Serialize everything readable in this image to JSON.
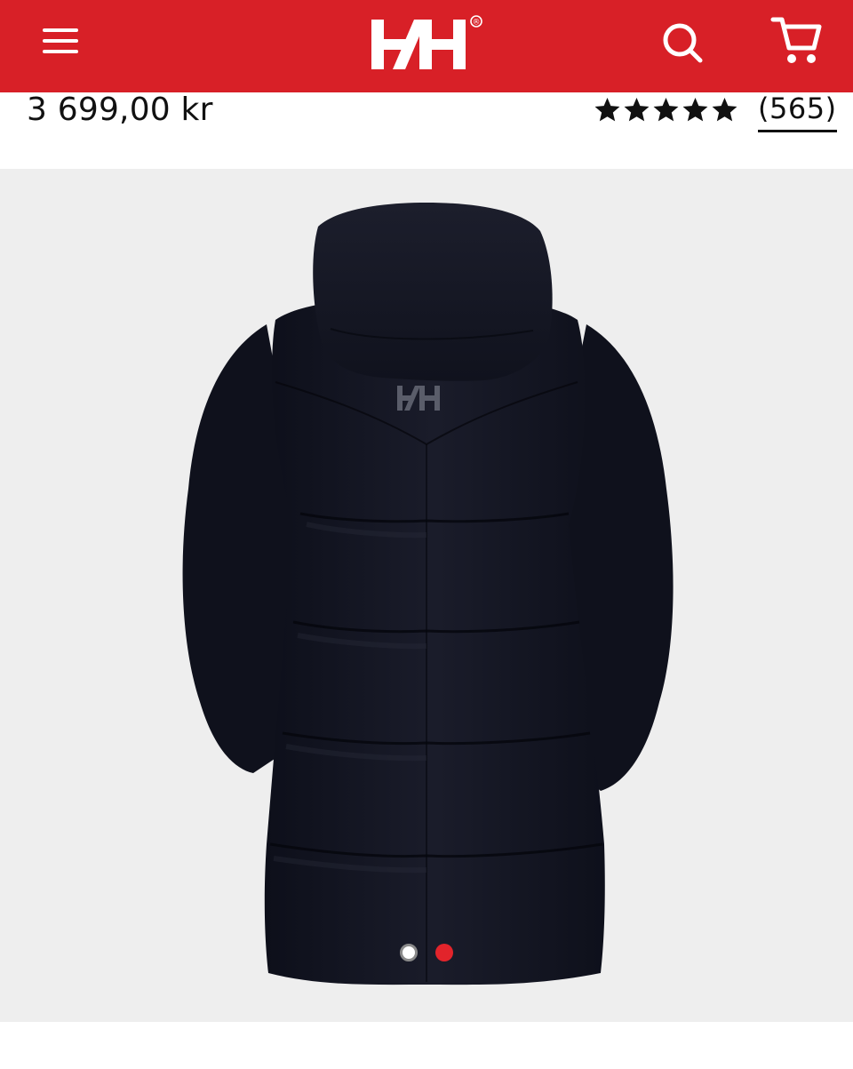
{
  "header": {
    "background_color": "#d82027",
    "menu_icon": "hamburger-menu-icon",
    "logo_icon": "helly-hansen-logo-icon",
    "logo_text": "H/H",
    "logo_mark": "®",
    "search_icon": "search-icon",
    "cart_icon": "shopping-cart-icon"
  },
  "product": {
    "price": "3 699,00 kr",
    "rating": {
      "stars": 5,
      "review_count": "(565)"
    }
  },
  "gallery": {
    "background_color": "#eeeeee",
    "image_subject": "black hooded long puffer coat, back view",
    "jacket_logo": "H/H",
    "dots": [
      {
        "state": "inactive"
      },
      {
        "state": "active",
        "color": "#e2242b"
      }
    ]
  }
}
